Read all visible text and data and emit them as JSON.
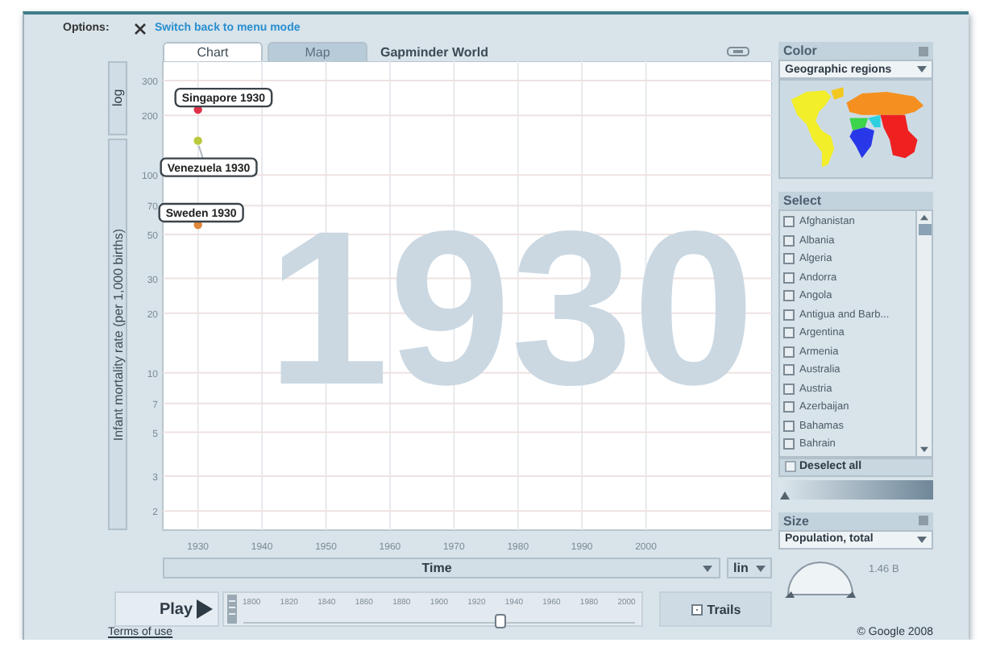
{
  "options": {
    "label": "Options:",
    "link": "Switch back to menu mode"
  },
  "tabs": [
    {
      "label": "Chart",
      "selected": true
    },
    {
      "label": "Map",
      "selected": false
    }
  ],
  "title": "Gapminder World",
  "y_axis": {
    "scale": "log",
    "title": "Infant mortality rate (per 1,000 births)",
    "ticks": [
      "300",
      "200",
      "100",
      "70",
      "50",
      "30",
      "20",
      "10",
      "7",
      "5",
      "3",
      "2"
    ]
  },
  "x_axis": {
    "scale": "lin",
    "title": "Time",
    "ticks": [
      "1930",
      "1940",
      "1950",
      "1960",
      "1970",
      "1980",
      "1990",
      "2000"
    ]
  },
  "chart": {
    "year": "1930",
    "bubbles": [
      {
        "label": "Singapore 1930",
        "color": "#e0304a"
      },
      {
        "label": "Venezuela 1930",
        "color": "#b9c93c"
      },
      {
        "label": "Sweden 1930",
        "color": "#e0883a"
      }
    ]
  },
  "play": {
    "label": "Play",
    "timeline": {
      "ticks": [
        "1800",
        "1820",
        "1840",
        "1860",
        "1880",
        "1900",
        "1920",
        "1940",
        "1960",
        "1980",
        "2000"
      ],
      "level": 0.65
    },
    "trails": {
      "label": "Trails",
      "checked": true
    }
  },
  "color": {
    "title": "Color",
    "indicator": "Geographic regions"
  },
  "select": {
    "title": "Select",
    "countries": [
      {
        "name": "Afghanistan",
        "checked": false
      },
      {
        "name": "Albania",
        "checked": false
      },
      {
        "name": "Algeria",
        "checked": false
      },
      {
        "name": "Andorra",
        "checked": false
      },
      {
        "name": "Angola",
        "checked": false
      },
      {
        "name": "Antigua and Barb...",
        "checked": false
      },
      {
        "name": "Argentina",
        "checked": false
      },
      {
        "name": "Armenia",
        "checked": false
      },
      {
        "name": "Australia",
        "checked": false
      },
      {
        "name": "Austria",
        "checked": false
      },
      {
        "name": "Azerbaijan",
        "checked": false
      },
      {
        "name": "Bahamas",
        "checked": false
      },
      {
        "name": "Bahrain",
        "checked": false
      }
    ],
    "deselect_all": "Deselect all",
    "opacity": {
      "level": 0
    }
  },
  "size": {
    "title": "Size",
    "indicator": "Population, total",
    "value": "1.46 B"
  },
  "footer": {
    "terms": "Terms of use",
    "copyright": "© Google 2008"
  }
}
